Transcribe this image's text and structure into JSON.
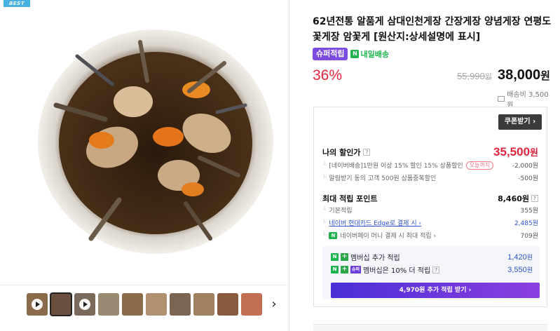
{
  "image": {
    "best_badge": "BEST"
  },
  "thumbnails": [
    {
      "kind": "video",
      "selected": false
    },
    {
      "kind": "image",
      "selected": true
    },
    {
      "kind": "video",
      "selected": false
    },
    {
      "kind": "image",
      "selected": false
    },
    {
      "kind": "image",
      "selected": false
    },
    {
      "kind": "image",
      "selected": false
    },
    {
      "kind": "image",
      "selected": false
    },
    {
      "kind": "image",
      "selected": false
    },
    {
      "kind": "image",
      "selected": false
    },
    {
      "kind": "image",
      "selected": false
    }
  ],
  "product": {
    "title": "62년전통 알품게 삼대인천게장 간장게장 양념게장 연평도 꽃게장 암꽃게 [원산지:상세설명에 표시]",
    "badge_fresh": "슈퍼적립",
    "badge_delivery_mark": "N",
    "badge_delivery": "내일배송",
    "discount": "36%",
    "original_price": "55,990",
    "original_unit": "원",
    "sale_price": "38,000",
    "sale_unit": "원",
    "shipping": "배송비 3,500원"
  },
  "benefit": {
    "coupon_button": "쿠폰받기 ›",
    "my_price_label": "나의 할인가",
    "my_price_help": "?",
    "my_price_value": "35,500",
    "my_price_unit": "원",
    "discounts": [
      {
        "label": "[네이버배송]1만원 이상 15% 할인 15% 상품할인",
        "tag": "오늘까지",
        "value": "-2,000원"
      },
      {
        "label": "알림받기 동의 고객 500원 상품중복할인",
        "tag": "",
        "value": "-500원"
      }
    ],
    "points_label": "최대 적립 포인트",
    "points_value": "8,460원",
    "points_help": "?",
    "points_rows": [
      {
        "label": "기본적립",
        "value": "355원",
        "type": "plain"
      },
      {
        "label": "네이버 현대카드 Edge로 결제 시 ›",
        "value": "2,485원",
        "type": "link"
      },
      {
        "label": "네이버페이 머니 결제 시 최대 적립 ›",
        "value": "709원",
        "type": "npay"
      }
    ],
    "member": {
      "row1_label": "멤버십 추가 적립",
      "row1_value": "1,420",
      "row1_unit": "원",
      "row2_tag": "슈퍼",
      "row2_label": "멤버십은 10% 더 적립",
      "row2_help": "?",
      "row2_value": "3,550",
      "row2_unit": "원",
      "cta": "4,970원 추가 적립 받기 ›"
    }
  },
  "colors": {
    "discount_red": "#e2253f",
    "badge_purple": "#7c4ce0",
    "delivery_green": "#1fb44f",
    "link_blue": "#2f54c7"
  }
}
